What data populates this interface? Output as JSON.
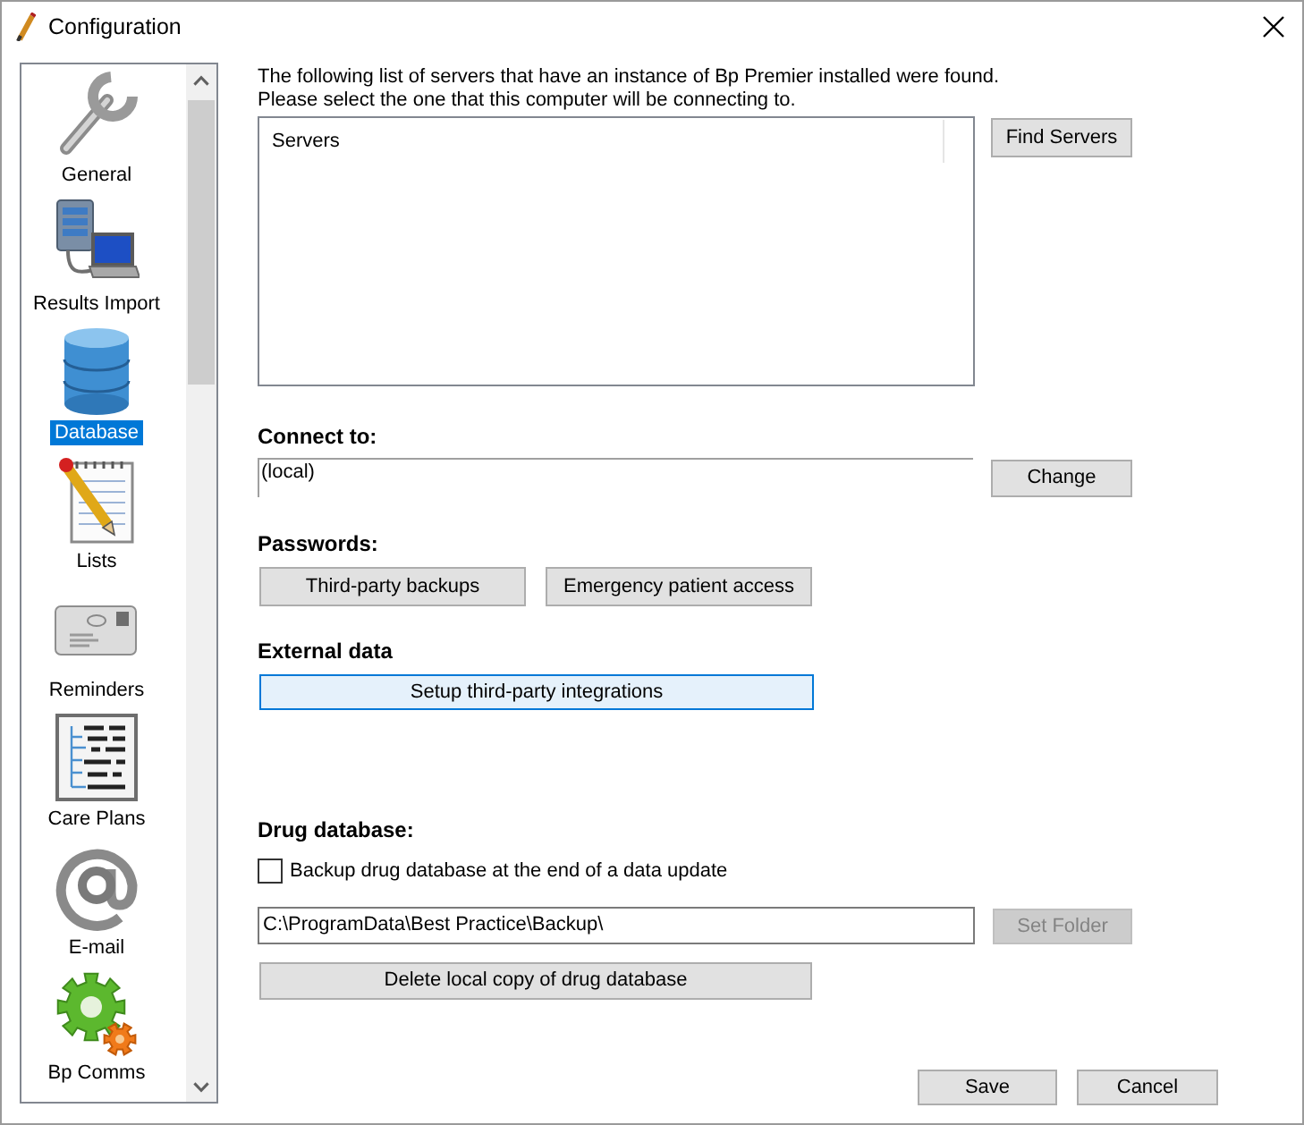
{
  "window": {
    "title": "Configuration"
  },
  "sidebar": {
    "items": [
      {
        "label": "General",
        "selected": false
      },
      {
        "label": "Results Import",
        "selected": false
      },
      {
        "label": "Database",
        "selected": true
      },
      {
        "label": "Lists",
        "selected": false
      },
      {
        "label": "Reminders",
        "selected": false
      },
      {
        "label": "Care Plans",
        "selected": false
      },
      {
        "label": "E-mail",
        "selected": false
      },
      {
        "label": "Bp Comms",
        "selected": false
      }
    ]
  },
  "servers": {
    "intro": [
      "The following list of servers that have an instance of Bp Premier installed were found.",
      "Please select the one that this computer will be connecting to."
    ],
    "columns": [
      "Servers"
    ],
    "find_button": "Find Servers"
  },
  "connect_to": {
    "label": "Connect to:",
    "value": "(local)",
    "change_button": "Change"
  },
  "passwords": {
    "label": "Passwords:",
    "buttons": [
      "Third-party backups",
      "Emergency patient access"
    ]
  },
  "external_data": {
    "label": "External data",
    "button": {
      "label": "Setup third-party integrations",
      "focused": true
    }
  },
  "drug_database": {
    "label": "Drug database:",
    "backup_checkbox": {
      "label": "Backup drug database at the end of a data update",
      "checked": false
    },
    "folder": {
      "value": "C:\\ProgramData\\Best Practice\\Backup\\"
    },
    "set_folder_button": {
      "label": "Set Folder",
      "disabled": true
    },
    "delete_button": "Delete local copy of drug database"
  },
  "footer": {
    "buttons": [
      "Save",
      "Cancel"
    ]
  }
}
